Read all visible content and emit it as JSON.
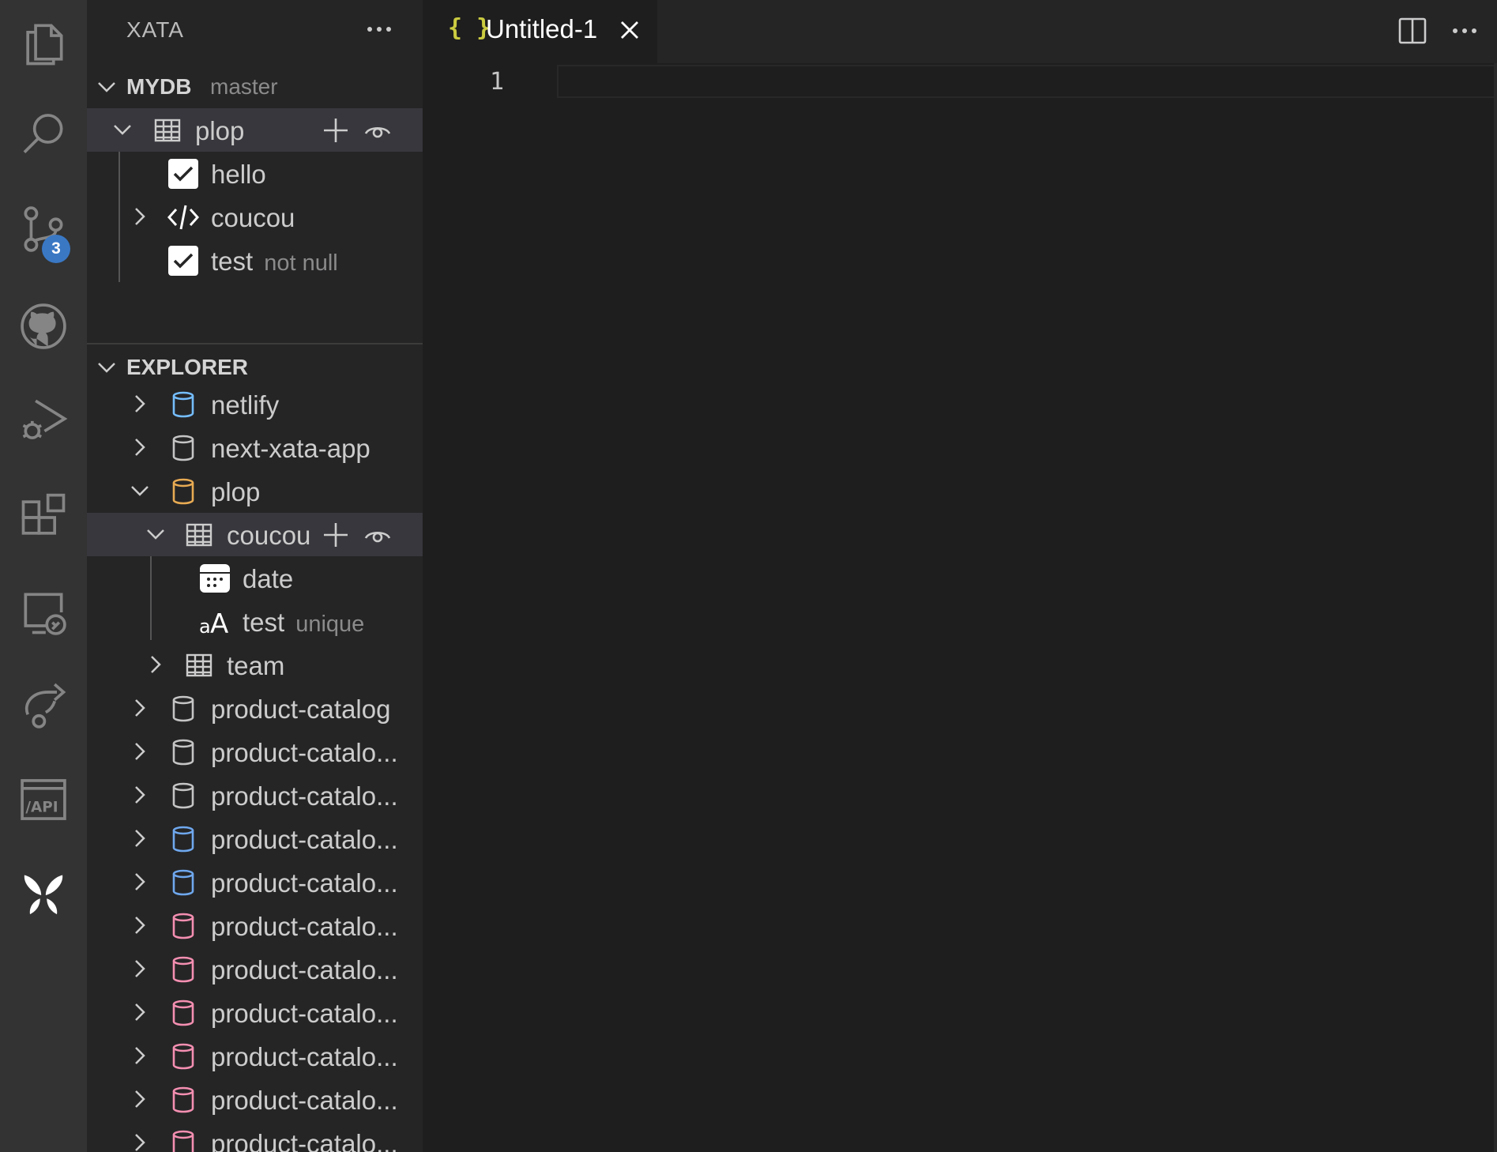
{
  "activity_bar": {
    "items": [
      {
        "icon": "files-icon"
      },
      {
        "icon": "search-icon"
      },
      {
        "icon": "source-control-icon",
        "badge": "3"
      },
      {
        "icon": "github-icon"
      },
      {
        "icon": "run-debug-icon"
      },
      {
        "icon": "extensions-icon"
      },
      {
        "icon": "remote-explorer-icon"
      },
      {
        "icon": "live-share-icon"
      },
      {
        "icon": "api-icon"
      },
      {
        "icon": "xata-logo-icon"
      }
    ]
  },
  "sidebar": {
    "title": "XATA",
    "mydb": {
      "label": "MYDB",
      "branch": "master",
      "table": {
        "label": "plop"
      },
      "columns": [
        {
          "label": "hello",
          "sub": ""
        },
        {
          "label": "coucou",
          "sub": ""
        },
        {
          "label": "test",
          "sub": "not null"
        }
      ]
    },
    "explorer": {
      "label": "EXPLORER",
      "items": [
        {
          "label": "netlify",
          "color": "#75beff"
        },
        {
          "label": "next-xata-app",
          "color": "#c5c5c5"
        },
        {
          "label": "plop",
          "color": "#e8ab53"
        }
      ],
      "plop_tables": {
        "coucou": {
          "label": "coucou",
          "columns": [
            {
              "label": "date",
              "sub": ""
            },
            {
              "label": "test",
              "sub": "unique"
            }
          ]
        },
        "team": {
          "label": "team"
        }
      },
      "catalogs": [
        {
          "label": "product-catalog",
          "color": "#c5c5c5"
        },
        {
          "label": "product-catalo...",
          "color": "#c5c5c5"
        },
        {
          "label": "product-catalo...",
          "color": "#c5c5c5"
        },
        {
          "label": "product-catalo...",
          "color": "#6fa8ee"
        },
        {
          "label": "product-catalo...",
          "color": "#6fa8ee"
        },
        {
          "label": "product-catalo...",
          "color": "#f48fb1"
        },
        {
          "label": "product-catalo...",
          "color": "#f48fb1"
        },
        {
          "label": "product-catalo...",
          "color": "#f48fb1"
        },
        {
          "label": "product-catalo...",
          "color": "#f48fb1"
        },
        {
          "label": "product-catalo...",
          "color": "#f48fb1"
        },
        {
          "label": "product-catalo...",
          "color": "#f48fb1"
        }
      ]
    }
  },
  "editor": {
    "tab": {
      "label": "Untitled-1",
      "icon_text": "{ }"
    },
    "line_numbers": [
      "1"
    ]
  },
  "colors": {
    "activity_bg": "#333333",
    "sidebar_bg": "#252526",
    "editor_bg": "#1e1e1e",
    "selected_row": "#37373d",
    "badge": "#3a78c4"
  }
}
